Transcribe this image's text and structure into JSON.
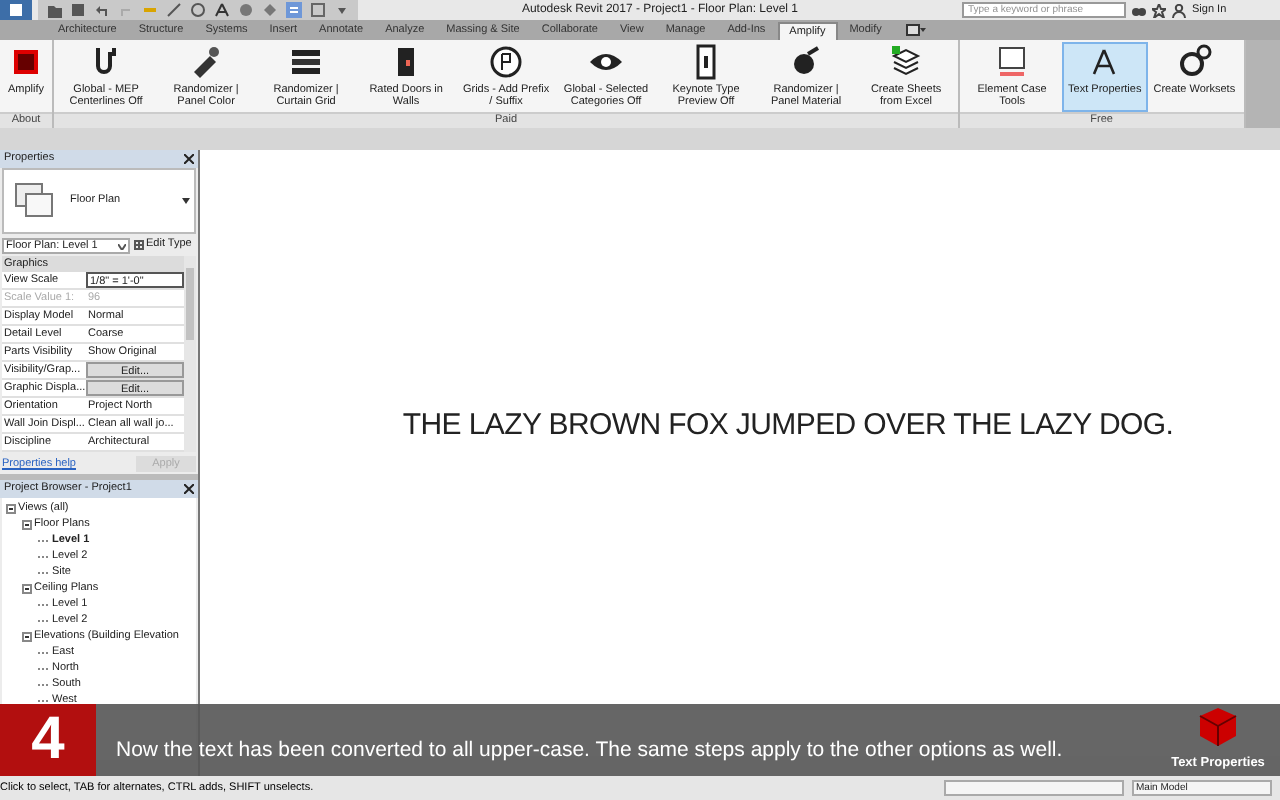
{
  "window": {
    "title": "Autodesk Revit 2017 -   Project1 - Floor Plan: Level 1",
    "search": {
      "placeholder": "Type a keyword or phrase"
    },
    "sign_in": "Sign In"
  },
  "tabs": [
    {
      "label": "Architecture",
      "selected": false
    },
    {
      "label": "Structure",
      "selected": false
    },
    {
      "label": "Systems",
      "selected": false
    },
    {
      "label": "Insert",
      "selected": false
    },
    {
      "label": "Annotate",
      "selected": false
    },
    {
      "label": "Analyze",
      "selected": false
    },
    {
      "label": "Massing & Site",
      "selected": false
    },
    {
      "label": "Collaborate",
      "selected": false
    },
    {
      "label": "View",
      "selected": false
    },
    {
      "label": "Manage",
      "selected": false
    },
    {
      "label": "Add-Ins",
      "selected": false
    },
    {
      "label": "Amplify",
      "selected": true
    },
    {
      "label": "Modify",
      "selected": false
    }
  ],
  "ribbon": [
    {
      "title": "About",
      "buttons": [
        {
          "label": "Amplify",
          "selected": false
        }
      ]
    },
    {
      "title": "Paid",
      "buttons": [
        {
          "label": "Global - MEP Centerlines Off",
          "selected": false
        },
        {
          "label": "Randomizer | Panel Color",
          "selected": false
        },
        {
          "label": "Randomizer | Curtain Grid",
          "selected": false
        },
        {
          "label": "Rated Doors in Walls",
          "selected": false
        },
        {
          "label": "Grids - Add Prefix / Suffix",
          "selected": false
        },
        {
          "label": "Global - Selected Categories Off",
          "selected": false
        },
        {
          "label": "Keynote Type Preview Off",
          "selected": false
        },
        {
          "label": "Randomizer | Panel Material",
          "selected": false
        },
        {
          "label": "Create Sheets from Excel",
          "selected": false
        }
      ]
    },
    {
      "title": "Free",
      "buttons": [
        {
          "label": "Element Case Tools",
          "selected": false
        },
        {
          "label": "Text Properties",
          "selected": true
        },
        {
          "label": "Create Worksets",
          "selected": false
        }
      ]
    }
  ],
  "properties": {
    "title": "Properties",
    "type_name": "Floor Plan",
    "selector": "Floor Plan: Level 1",
    "edit_type": "Edit Type",
    "group": "Graphics",
    "rows": [
      {
        "label": "View Scale",
        "value": "1/8\" = 1'-0\"",
        "kind": "field",
        "disabled": false
      },
      {
        "label": "Scale Value    1:",
        "value": "96",
        "kind": "text",
        "disabled": true
      },
      {
        "label": "Display Model",
        "value": "Normal",
        "kind": "text",
        "disabled": false
      },
      {
        "label": "Detail Level",
        "value": "Coarse",
        "kind": "text",
        "disabled": false
      },
      {
        "label": "Parts Visibility",
        "value": "Show Original",
        "kind": "text",
        "disabled": false
      },
      {
        "label": "Visibility/Grap...",
        "value": "Edit...",
        "kind": "button",
        "disabled": false
      },
      {
        "label": "Graphic Displa...",
        "value": "Edit...",
        "kind": "button",
        "disabled": false
      },
      {
        "label": "Orientation",
        "value": "Project North",
        "kind": "text",
        "disabled": false
      },
      {
        "label": "Wall Join Displ...",
        "value": "Clean all wall jo...",
        "kind": "text",
        "disabled": false
      },
      {
        "label": "Discipline",
        "value": "Architectural",
        "kind": "text",
        "disabled": false
      }
    ],
    "help": "Properties help",
    "apply": {
      "label": "Apply",
      "disabled": true
    }
  },
  "project_browser": {
    "title": "Project Browser - Project1",
    "tree": [
      {
        "label": "Views (all)",
        "bold": false,
        "children": [
          {
            "label": "Floor Plans",
            "bold": false,
            "children": [
              {
                "label": "Level 1",
                "bold": true
              },
              {
                "label": "Level 2",
                "bold": false
              },
              {
                "label": "Site",
                "bold": false
              }
            ]
          },
          {
            "label": "Ceiling Plans",
            "bold": false,
            "children": [
              {
                "label": "Level 1",
                "bold": false
              },
              {
                "label": "Level 2",
                "bold": false
              }
            ]
          },
          {
            "label": "Elevations (Building Elevation",
            "bold": false,
            "children": [
              {
                "label": "East",
                "bold": false
              },
              {
                "label": "North",
                "bold": false
              },
              {
                "label": "South",
                "bold": false
              },
              {
                "label": "West",
                "bold": false
              }
            ]
          }
        ]
      }
    ]
  },
  "canvas": {
    "text": "THE LAZY BROWN FOX JUMPED OVER THE LAZY DOG."
  },
  "tutorial": {
    "step": "4",
    "caption": "Now the text has been converted to all upper-case. The same steps apply to the other options as well.",
    "badge": "Text Properties"
  },
  "status_bar": {
    "message": "Click to select, TAB for alternates, CTRL adds, SHIFT unselects.",
    "model": "Main Model"
  }
}
